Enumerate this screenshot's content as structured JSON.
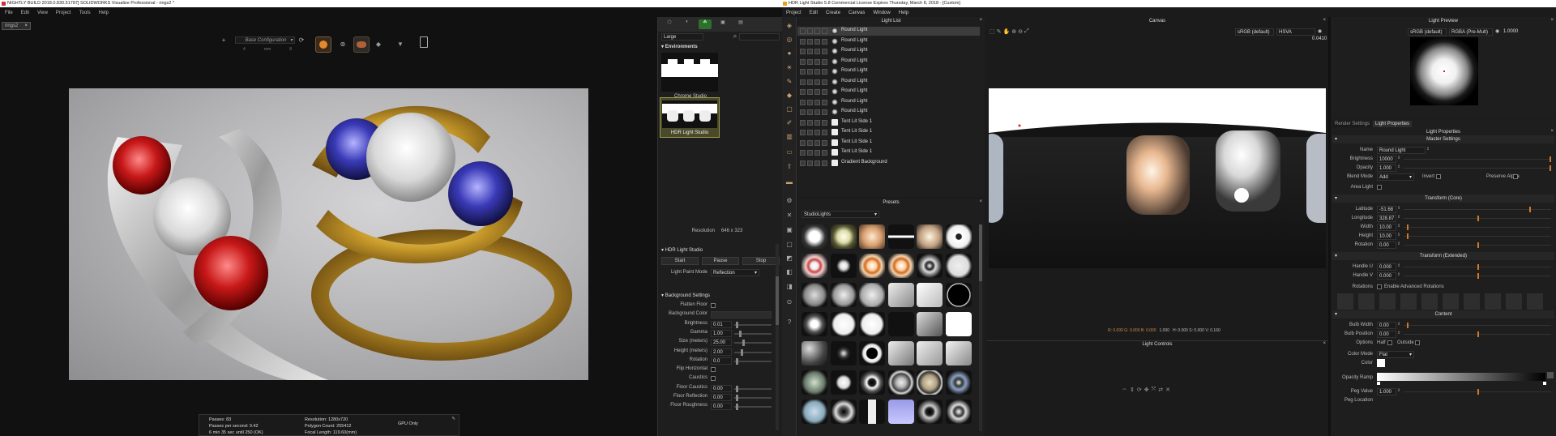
{
  "sw": {
    "title": "NIGHTLY BUILD 2018.0.830.51787] SOLIDWORKS Visualize Professional - rings2 *",
    "menu": [
      "File",
      "Edit",
      "View",
      "Project",
      "Tools",
      "Help"
    ],
    "doc_tab": "rings2",
    "config": "Base Configuration",
    "dims": [
      "4",
      "mm",
      "8"
    ],
    "env_header": "Environments",
    "size_select": "Large",
    "env_items": [
      "Chrome Studio",
      "HDR Light Studio"
    ],
    "resolution_label": "Resolution",
    "resolution_value": "646 x 323",
    "hdr_section": "HDR Light Studio",
    "hdr_buttons": [
      "Start",
      "Pause",
      "Stop"
    ],
    "paint_mode_label": "Light Paint Mode",
    "paint_mode_value": "Reflection",
    "bg_section": "Background Settings",
    "bg_rows": [
      {
        "label": "Flatten Floor",
        "value": ""
      },
      {
        "label": "Background Color",
        "value": ""
      },
      {
        "label": "Brightness",
        "value": "0.01"
      },
      {
        "label": "Gamma",
        "value": "1.00"
      },
      {
        "label": "Size (meters)",
        "value": "25.00"
      },
      {
        "label": "Height (meters)",
        "value": "2.00"
      },
      {
        "label": "Rotation",
        "value": "0.0"
      },
      {
        "label": "Flip Horizontal",
        "value": ""
      },
      {
        "label": "Caustics",
        "value": ""
      },
      {
        "label": "Floor Caustics",
        "value": "0.00"
      },
      {
        "label": "Floor Reflection",
        "value": "0.00"
      },
      {
        "label": "Floor Roughness",
        "value": "0.00"
      }
    ],
    "status": {
      "passes": "Passes: 83",
      "pps": "Passes per second: 0.42",
      "time": "6 min 35 sec until 250 (OK)",
      "resolution": "Resolution: 1280x720",
      "polys": "Polygon Count: 255412",
      "focal": "Focal Length: 119.60(mm)",
      "gpu": "GPU Only"
    }
  },
  "hdr": {
    "title": "HDR Light Studio 5.8 Commercial License Expires Thursday, March 8, 2018 - [Custom]",
    "menu": [
      "Project",
      "Edit",
      "Create",
      "Canvas",
      "Window",
      "Help"
    ],
    "light_list_title": "Light List",
    "lights": [
      "Round Light",
      "Round Light",
      "Round Light",
      "Round Light",
      "Round Light",
      "Round Light",
      "Round Light",
      "Round Light",
      "Round Light",
      "Tent Lit Side 1",
      "Tent Lit Side 1",
      "Tent Lit Side 1",
      "Tent Lit Side 1",
      "Gradient Background"
    ],
    "presets_title": "Presets",
    "presets_category": "StudioLights",
    "canvas_title": "Canvas",
    "canvas_colorspace": "sRGB (default)",
    "canvas_mode": "HSVA",
    "canvas_exposure": "0.0410",
    "canvas_status_rgb": "R: 0.000 G: 0.000 B: 0.000",
    "canvas_status_a": "1.000",
    "canvas_status_hsv": "H: 0.000 S: 0.000 V: 0.160",
    "light_controls_title": "Light Controls",
    "preview_title": "Light Preview",
    "preview_colorspace": "sRGB (default)",
    "preview_mode": "RGBA (Pre-Mult)",
    "preview_exposure": "1.0000",
    "tabs": [
      "Render Settings",
      "Light Properties"
    ],
    "props_title": "Light Properties",
    "master_section": "Master Settings",
    "name_label": "Name",
    "name_value": "Round Light",
    "brightness_label": "Brightness",
    "brightness_value": "10000",
    "opacity_label": "Opacity",
    "opacity_value": "1.000",
    "blend_label": "Blend Mode",
    "blend_value": "Add",
    "invert_label": "Invert",
    "preserve_alpha_label": "Preserve Alpha",
    "area_light_label": "Area Light",
    "transform_core": "Transform (Core)",
    "latitude_label": "Latitude",
    "latitude_value": "-51.68",
    "longitude_label": "Longitude",
    "longitude_value": "328.87",
    "width_label": "Width",
    "width_value": "10.00",
    "height_label": "Height",
    "height_value": "10.00",
    "rotation_label": "Rotation",
    "rotation_value": "0.00",
    "transform_ext": "Transform (Extended)",
    "handle_u_label": "Handle U",
    "handle_u_value": "0.000",
    "handle_v_label": "Handle V",
    "handle_v_value": "0.000",
    "rotations_label": "Rotations",
    "adv_rot_label": "Enable Advanced Rotations",
    "content_section": "Content",
    "bulb_width_label": "Bulb Width",
    "bulb_width_value": "0.00",
    "bulb_pos_label": "Bulb Position",
    "bulb_pos_value": "0.00",
    "options_label": "Options",
    "half_label": "Half",
    "outside_label": "Outside",
    "color_mode_label": "Color Mode",
    "color_mode_value": "Flat",
    "color_label": "Color",
    "opacity_ramp_label": "Opacity Ramp",
    "peg_value_label": "Peg Value",
    "peg_value": "1.000",
    "peg_location_label": "Peg Location"
  },
  "colors": {
    "accent": "#d0782a",
    "panel": "#1e1e1e",
    "header": "#262626",
    "selected": "#3d3d3d"
  }
}
